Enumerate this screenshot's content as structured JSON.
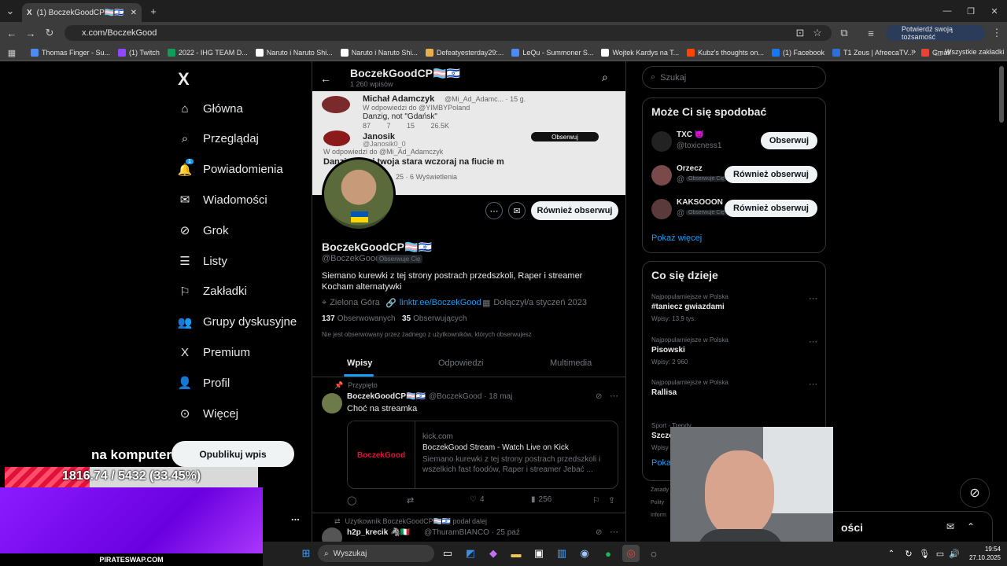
{
  "browser": {
    "tab_title": "(1) BoczekGoodCP🏳️‍⚧️🇮🇱 (@Boc",
    "tab_x_icon": "X",
    "new_tab": "+",
    "url": "x.com/BoczekGood",
    "verify_label": "Potwierdź swoją tożsamość",
    "bookmarks": [
      {
        "label": "Thomas Finger - Su...",
        "color": "#4c8bf5"
      },
      {
        "label": "(1) Twitch",
        "color": "#9146ff"
      },
      {
        "label": "2022 - IHG TEAM D...",
        "color": "#0f9d58"
      },
      {
        "label": "Naruto i Naruto Shi...",
        "color": "#ffffff"
      },
      {
        "label": "Naruto i Naruto Shi...",
        "color": "#ffffff"
      },
      {
        "label": "Defeatyesterday29:...",
        "color": "#e8b04b"
      },
      {
        "label": "LeQu - Summoner S...",
        "color": "#4c8bf5"
      },
      {
        "label": "Wojtek Kardys na T...",
        "color": "#ffffff"
      },
      {
        "label": "Kubz's thoughts on...",
        "color": "#ff4500"
      },
      {
        "label": "(1) Facebook",
        "color": "#1877f2"
      },
      {
        "label": "T1 Zeus | AfreecaTV...",
        "color": "#2f6fd8"
      },
      {
        "label": "Gmail",
        "color": "#ea4335"
      }
    ],
    "bookmarks_more": "»",
    "all_bookmarks": "Wszystkie zakładki"
  },
  "nav": {
    "logo": "X",
    "items": [
      {
        "label": "Główna",
        "icon": "home-icon"
      },
      {
        "label": "Przeglądaj",
        "icon": "search-icon"
      },
      {
        "label": "Powiadomienia",
        "icon": "bell-icon",
        "badge": "1"
      },
      {
        "label": "Wiadomości",
        "icon": "envelope-icon"
      },
      {
        "label": "Grok",
        "icon": "grok-icon"
      },
      {
        "label": "Listy",
        "icon": "list-icon"
      },
      {
        "label": "Zakładki",
        "icon": "bookmark-icon"
      },
      {
        "label": "Grupy dyskusyjne",
        "icon": "people-icon"
      },
      {
        "label": "Premium",
        "icon": "x-icon"
      },
      {
        "label": "Profil",
        "icon": "person-icon"
      },
      {
        "label": "Więcej",
        "icon": "more-circle-icon"
      }
    ],
    "post_button": "Opublikuj wpis",
    "overlay_text": "na komputer",
    "account_more": "..."
  },
  "profile": {
    "header_name": "BoczekGoodCP🏳️‍⚧️🇮🇱",
    "header_posts": "1 260 wpisów",
    "banner": {
      "line1_name": "Michał Adamczyk",
      "line1_handle": "@Mi_Ad_Adamc... · 15 g.",
      "line2": "W odpowiedzi do @YIMBYPoland",
      "line3": "Danzig, not \"Gdańsk\"",
      "stats": "87   7   15   26.5K",
      "line4_name": "Janosik",
      "line4_handle": "@Janosik0_0",
      "line4_button": "Obserwuj",
      "line5": "W odpowiedzi do @Mi_Ad_Adamczyk",
      "line6": "Danzig to mi twoja stara wczoraj na fiucie m",
      "line7": "25 · 6 Wyświetlenia"
    },
    "follow_back": "Również obserwuj",
    "display_name": "BoczekGoodCP🏳️‍⚧️🇮🇱",
    "handle": "@BoczekGood",
    "follows_you": "Obserwuje Cię",
    "bio1": "Siemano kurewki z tej strony postrach przedszkoli, Raper i streamer",
    "bio2": "Kocham alternatywki",
    "location": "Zielona Góra",
    "link": "linktr.ee/BoczekGood",
    "joined": "Dołączył/a styczeń 2023",
    "following_count": "137",
    "following_label": "Obserwowanych",
    "followers_count": "35",
    "followers_label": "Obserwujących",
    "not_followed": "Nie jest obserwowany przez żadnego z użytkowników, których obserwujesz",
    "tabs": [
      "Wpisy",
      "Odpowiedzi",
      "Multimedia"
    ]
  },
  "tweets": {
    "pinned_label": "Przypięto",
    "t1_name": "BoczekGoodCP🏳️‍⚧️🇮🇱",
    "t1_meta": "@BoczekGood · 18 maj",
    "t1_text": "Choć na streamka",
    "card_logo": "BoczekGood",
    "card_domain": "kick.com",
    "card_title": "BoczekGood Stream - Watch Live on Kick",
    "card_desc": "Siemano kurewki z tej strony postrach przedszkoli i wszelkich fast foodów, Raper i streamer Jebać ...",
    "t1_likes": "4",
    "t1_views": "256",
    "repost_label": "Użytkownik BoczekGoodCP🏳️‍⚧️🇮🇱 podał dalej",
    "t2_name": "h2p_krecik 🦓🇮🇹",
    "t2_meta": "@ThuramBIANCO · 25 paź"
  },
  "right": {
    "search_placeholder": "Szukaj",
    "suggest_title": "Może Ci się spodobać",
    "suggestions": [
      {
        "name": "TXC 😈",
        "handle": "@toxicness1",
        "badge": "",
        "button": "Obserwuj"
      },
      {
        "name": "Orzecz",
        "handle": "@",
        "badge": "Obserwuje Cię",
        "button": "Również obserwuj"
      },
      {
        "name": "KAKSOOON",
        "handle": "@",
        "badge": "Obserwuje Cię",
        "button": "Również obserwuj"
      }
    ],
    "show_more": "Pokaż więcej",
    "trends_title": "Co się dzieje",
    "trends": [
      {
        "context": "Najpopularniejsze w Polska",
        "name": "#taniecz gwiazdami",
        "count": "Wpisy: 13,9 tys."
      },
      {
        "context": "Najpopularniejsze w Polska",
        "name": "Pisowski",
        "count": "Wpisy: 2 960"
      },
      {
        "context": "Najpopularniejsze w Polska",
        "name": "Rallisa",
        "count": ""
      },
      {
        "context": "Sport · Trendy",
        "name": "Szczęsny",
        "count": "Wpisy"
      }
    ],
    "show_more2": "Poka",
    "footer1": "Zasady",
    "footer2": "Polity",
    "footer3": "Inform",
    "messages_partial": "ości"
  },
  "overlay": {
    "goal": "1816.74 / 5432 (33.45%)",
    "goal_progress": 0.3345,
    "brand": "PIRATESWAP.COM"
  },
  "taskbar": {
    "search": "Wyszukaj",
    "time": "19:54",
    "date": "27.10.2025"
  }
}
